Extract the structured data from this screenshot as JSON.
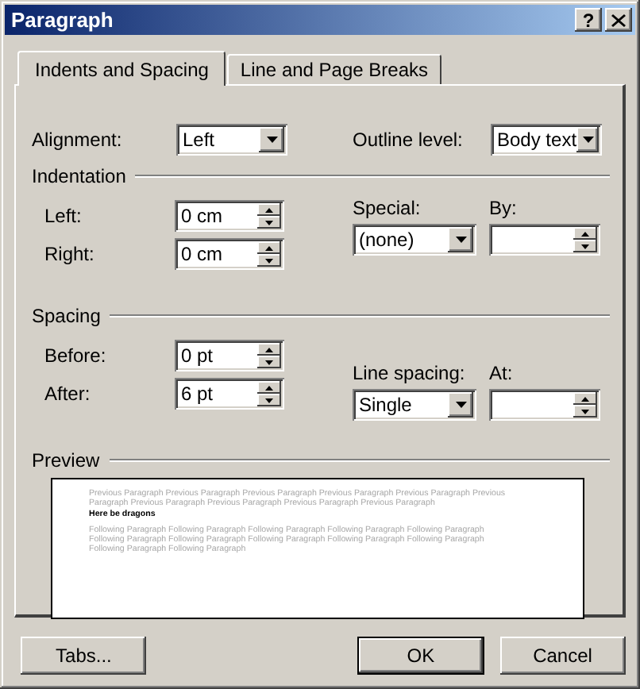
{
  "window": {
    "title": "Paragraph",
    "help_button": "?"
  },
  "tabs": [
    {
      "label": "Indents and Spacing",
      "selected": true
    },
    {
      "label": "Line and Page Breaks",
      "selected": false
    }
  ],
  "general": [
    {
      "label": "Alignment:",
      "kind": "combo",
      "value": "Left"
    },
    {
      "label": "Outline level:",
      "kind": "combo",
      "value": "Body text"
    }
  ],
  "indentation": {
    "title": "Indentation",
    "left": [
      {
        "label": "Left:",
        "kind": "spin",
        "value": "0 cm"
      },
      {
        "label": "Right:",
        "kind": "spin",
        "value": "0 cm"
      }
    ],
    "right": [
      {
        "label": "Special:",
        "kind": "combo",
        "value": "(none)"
      },
      {
        "label": "By:",
        "kind": "spin"
      }
    ]
  },
  "spacing": {
    "title": "Spacing",
    "left": [
      {
        "label": "Before:",
        "kind": "spin",
        "value": "0 pt"
      },
      {
        "label": "After:",
        "kind": "spin",
        "value": "6 pt"
      }
    ],
    "right": [
      {
        "label": "Line spacing:",
        "kind": "combo",
        "value": "Single"
      },
      {
        "label": "At:",
        "kind": "spin"
      }
    ]
  },
  "preview": {
    "title": "Preview",
    "previous": "Previous Paragraph Previous Paragraph Previous Paragraph Previous Paragraph Previous Paragraph Previous Paragraph Previous Paragraph Previous Paragraph Previous Paragraph Previous Paragraph",
    "current": "Here be dragons",
    "following": "Following Paragraph Following Paragraph Following Paragraph Following Paragraph Following Paragraph Following Paragraph Following Paragraph Following Paragraph Following Paragraph Following Paragraph Following Paragraph Following Paragraph"
  },
  "buttons": [
    {
      "label": "Tabs...",
      "default": false
    },
    {
      "label": "OK",
      "default": true
    },
    {
      "label": "Cancel",
      "default": false
    }
  ]
}
